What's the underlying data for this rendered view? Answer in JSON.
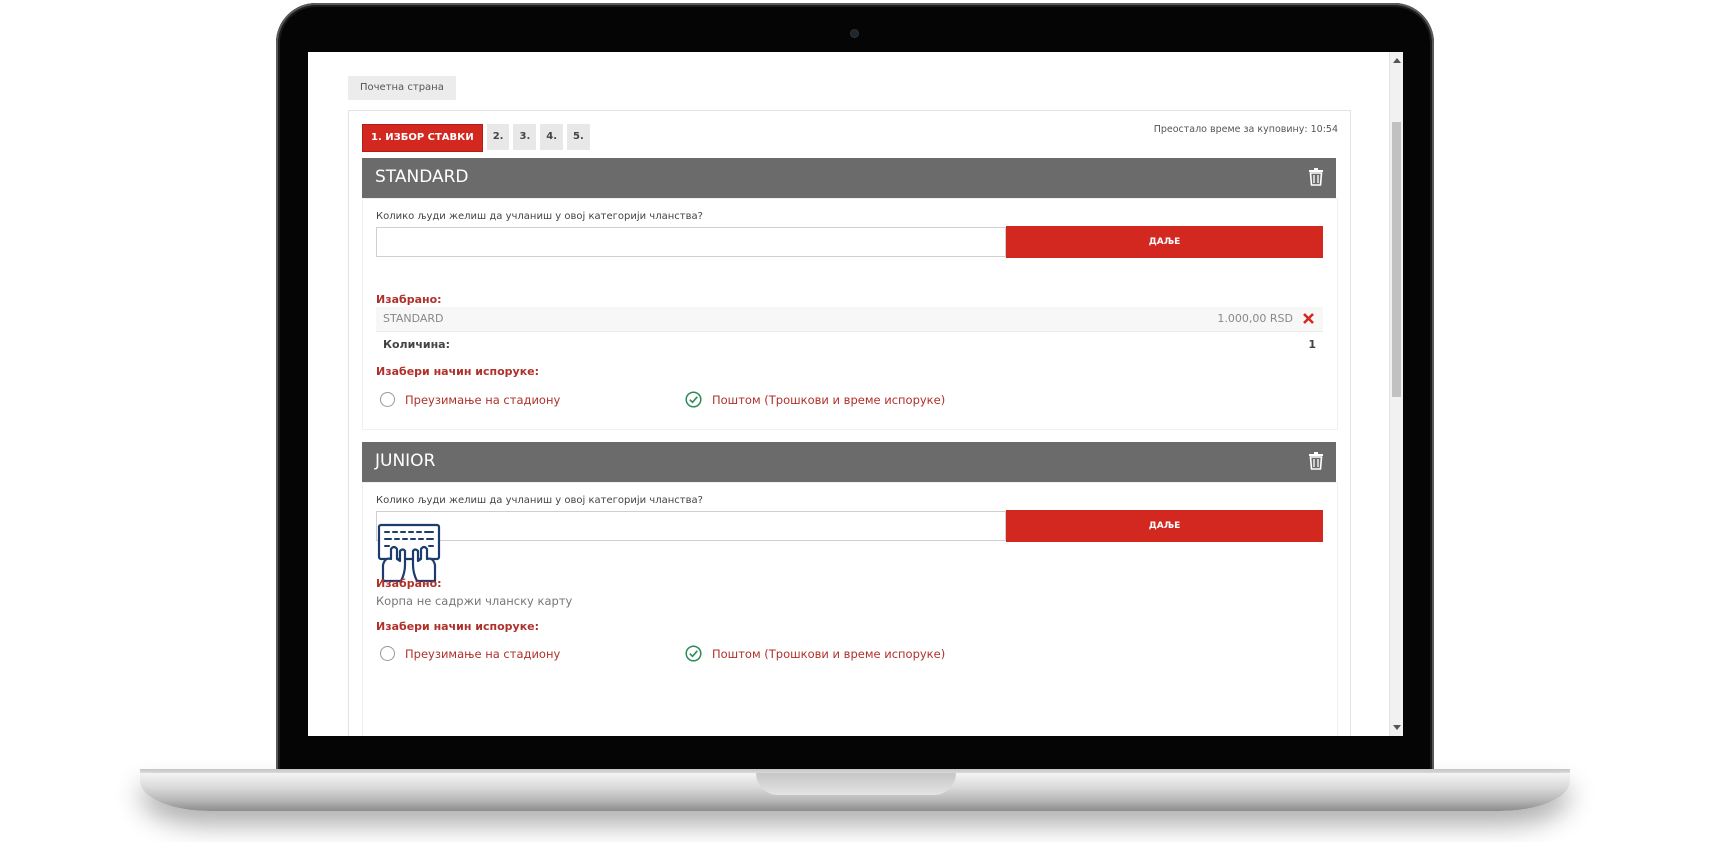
{
  "breadcrumb": {
    "home": "Почетна страна"
  },
  "steps": [
    "1. ИЗБОР СТАВКИ",
    "2.",
    "3.",
    "4.",
    "5."
  ],
  "timer": "Преостало време за куповину: 10:54",
  "categories": [
    {
      "title": "STANDARD",
      "question": "Колико људи желиш да учланиш у овој категорији чланства?",
      "input_value": "",
      "next_label": "ДАЉЕ",
      "selected_label": "Изабрано:",
      "item_name": "STANDARD",
      "item_price": "1.000,00 RSD",
      "qty_label": "Количина:",
      "qty_value": "1",
      "delivery_label": "Изабери начин испоруке:",
      "option_pickup": "Преузимање на стадиону",
      "option_post": "Поштом (Трошкови и време испоруке)"
    },
    {
      "title": "JUNIOR",
      "question": "Колико људи желиш да учланиш у овој категорији чланства?",
      "input_value": "",
      "next_label": "ДАЉЕ",
      "selected_label": "Изабрано:",
      "empty_text": "Корпа не садржи чланску карту",
      "delivery_label": "Изабери начин испоруке:",
      "option_pickup": "Преузимање на стадиону",
      "option_post": "Поштом (Трошкови и време испоруке)"
    }
  ],
  "colors": {
    "accent": "#d3281f",
    "header_gray": "#6b6b6b",
    "label_red": "#b0302a",
    "check_green": "#2e8b57"
  },
  "icons": [
    "trash-icon",
    "close-icon",
    "check-circle-icon",
    "keyboard-hands-icon"
  ]
}
